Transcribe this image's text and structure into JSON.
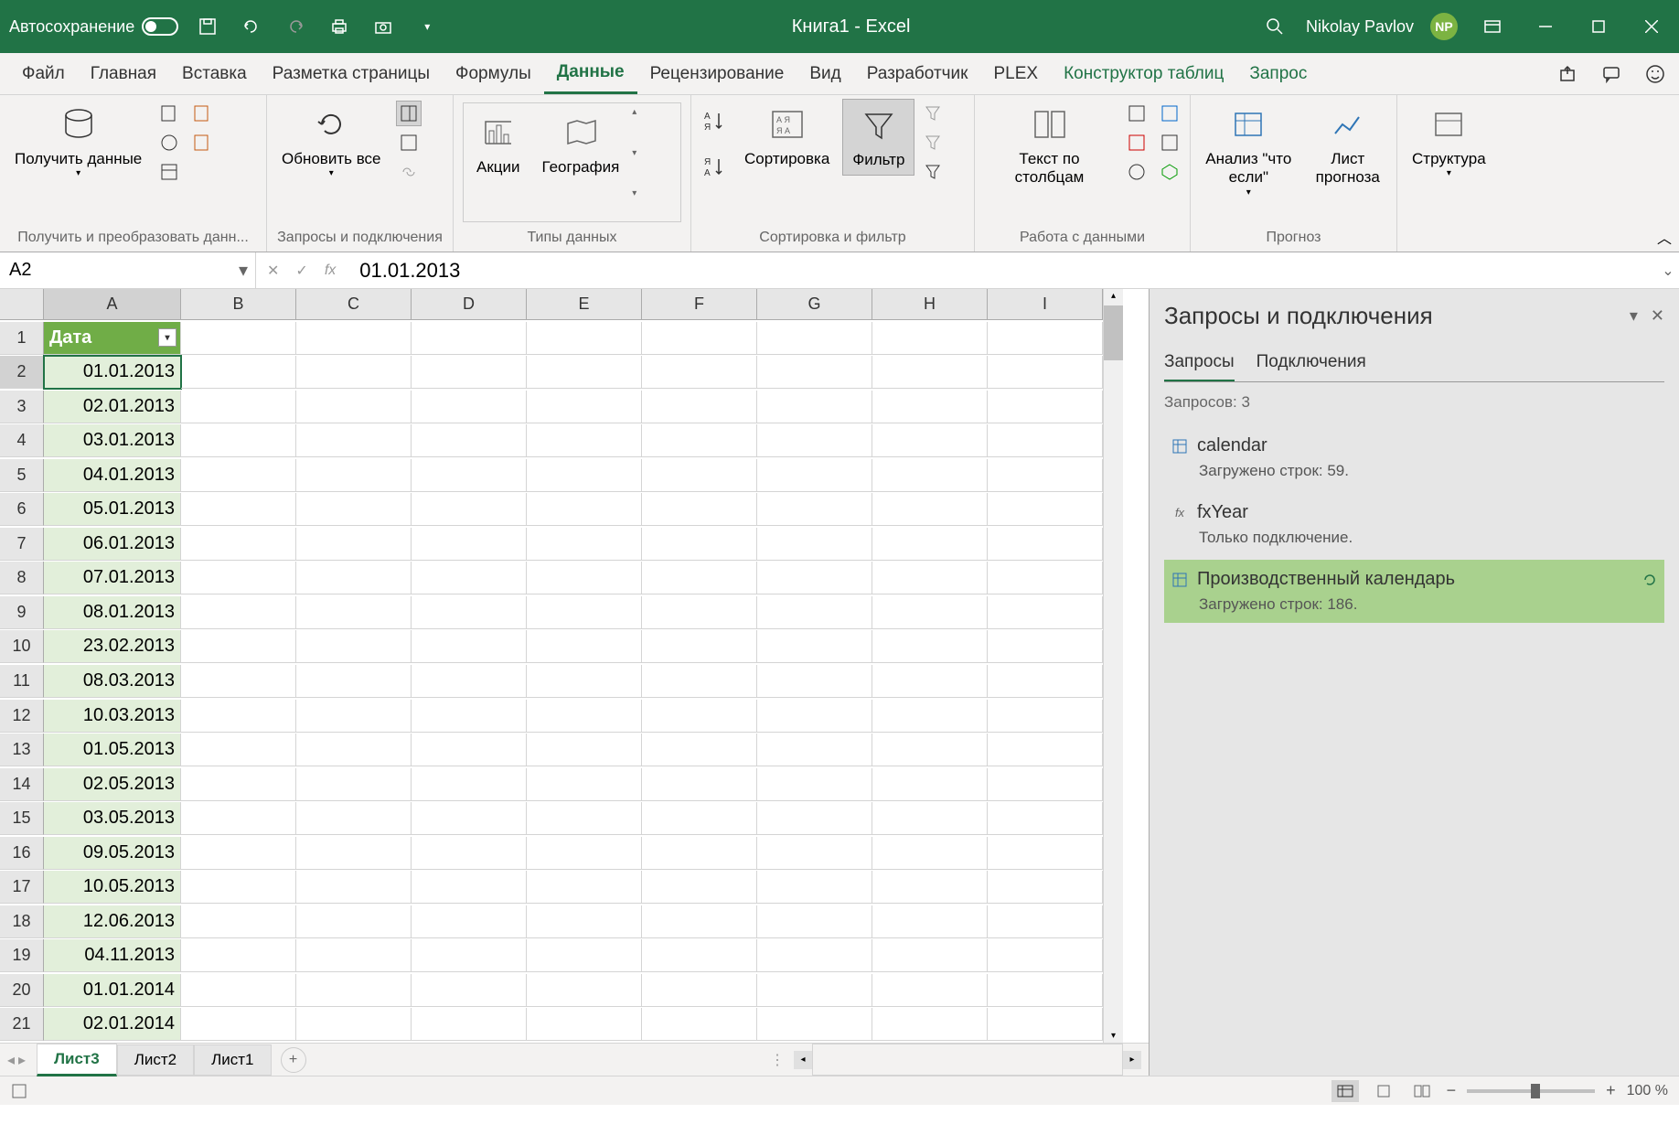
{
  "titlebar": {
    "autosave": "Автосохранение",
    "title": "Книга1  -  Excel",
    "user": "Nikolay Pavlov",
    "user_initials": "NP"
  },
  "tabs": {
    "file": "Файл",
    "home": "Главная",
    "insert": "Вставка",
    "page_layout": "Разметка страницы",
    "formulas": "Формулы",
    "data": "Данные",
    "review": "Рецензирование",
    "view": "Вид",
    "developer": "Разработчик",
    "plex": "PLEX",
    "table_design": "Конструктор таблиц",
    "query": "Запрос"
  },
  "ribbon": {
    "get_data": "Получить данные",
    "group_get": "Получить и преобразовать данн...",
    "refresh_all": "Обновить все",
    "group_queries": "Запросы и подключения",
    "stocks": "Акции",
    "geography": "География",
    "group_types": "Типы данных",
    "sort": "Сортировка",
    "filter": "Фильтр",
    "group_sort": "Сортировка и фильтр",
    "text_cols": "Текст по столбцам",
    "group_tools": "Работа с данными",
    "whatif": "Анализ \"что если\"",
    "forecast": "Лист прогноза",
    "group_forecast": "Прогноз",
    "outline": "Структура"
  },
  "formula_bar": {
    "name_box": "A2",
    "formula": "01.01.2013"
  },
  "sheet": {
    "columns": [
      "A",
      "B",
      "C",
      "D",
      "E",
      "F",
      "G",
      "H",
      "I"
    ],
    "header_a1": "Дата",
    "rows": [
      {
        "n": 1,
        "a": "Дата"
      },
      {
        "n": 2,
        "a": "01.01.2013"
      },
      {
        "n": 3,
        "a": "02.01.2013"
      },
      {
        "n": 4,
        "a": "03.01.2013"
      },
      {
        "n": 5,
        "a": "04.01.2013"
      },
      {
        "n": 6,
        "a": "05.01.2013"
      },
      {
        "n": 7,
        "a": "06.01.2013"
      },
      {
        "n": 8,
        "a": "07.01.2013"
      },
      {
        "n": 9,
        "a": "08.01.2013"
      },
      {
        "n": 10,
        "a": "23.02.2013"
      },
      {
        "n": 11,
        "a": "08.03.2013"
      },
      {
        "n": 12,
        "a": "10.03.2013"
      },
      {
        "n": 13,
        "a": "01.05.2013"
      },
      {
        "n": 14,
        "a": "02.05.2013"
      },
      {
        "n": 15,
        "a": "03.05.2013"
      },
      {
        "n": 16,
        "a": "09.05.2013"
      },
      {
        "n": 17,
        "a": "10.05.2013"
      },
      {
        "n": 18,
        "a": "12.06.2013"
      },
      {
        "n": 19,
        "a": "04.11.2013"
      },
      {
        "n": 20,
        "a": "01.01.2014"
      },
      {
        "n": 21,
        "a": "02.01.2014"
      }
    ]
  },
  "panel": {
    "title": "Запросы и подключения",
    "tab_queries": "Запросы",
    "tab_connections": "Подключения",
    "count": "Запросов: 3",
    "q1_name": "calendar",
    "q1_status": "Загружено строк: 59.",
    "q2_name": "fxYear",
    "q2_status": "Только подключение.",
    "q3_name": "Производственный календарь",
    "q3_status": "Загружено строк: 186."
  },
  "sheet_tabs": {
    "s3": "Лист3",
    "s2": "Лист2",
    "s1": "Лист1"
  },
  "status": {
    "zoom": "100 %"
  }
}
